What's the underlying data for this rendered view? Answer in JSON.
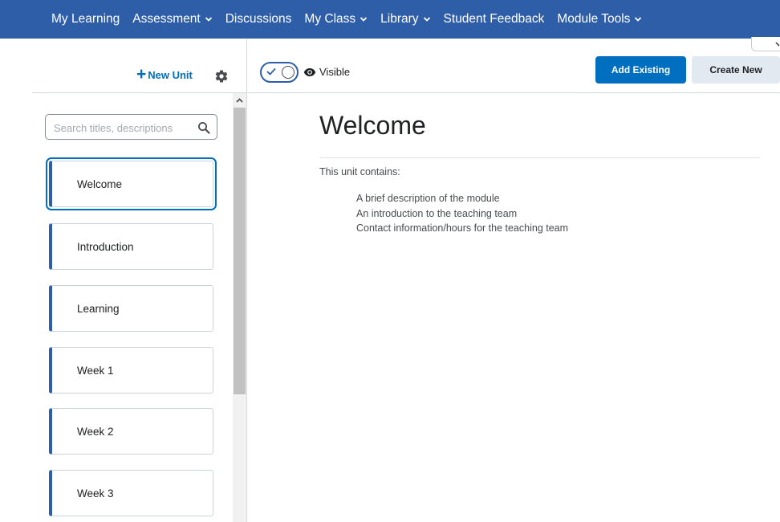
{
  "nav": {
    "items": [
      {
        "label": "My Learning",
        "dropdown": false
      },
      {
        "label": "Assessment",
        "dropdown": true
      },
      {
        "label": "Discussions",
        "dropdown": false
      },
      {
        "label": "My Class",
        "dropdown": true
      },
      {
        "label": "Library",
        "dropdown": true
      },
      {
        "label": "Student Feedback",
        "dropdown": false
      },
      {
        "label": "Module Tools",
        "dropdown": true
      }
    ]
  },
  "sidebar": {
    "new_unit_label": "New Unit",
    "search_placeholder": "Search titles, descriptions",
    "units": [
      {
        "label": "Welcome",
        "selected": true
      },
      {
        "label": "Introduction",
        "selected": false
      },
      {
        "label": "Learning",
        "selected": false
      },
      {
        "label": "Week 1",
        "selected": false
      },
      {
        "label": "Week 2",
        "selected": false
      },
      {
        "label": "Week 3",
        "selected": false
      }
    ]
  },
  "main": {
    "visibility_label": "Visible",
    "visibility_on": true,
    "add_existing_label": "Add Existing",
    "create_new_label": "Create New",
    "title": "Welcome",
    "intro": "This unit contains:",
    "contents": [
      "A brief description of the module",
      "An introduction to the teaching team",
      "Contact information/hours for the teaching team"
    ]
  },
  "colors": {
    "nav_background": "#2f5ea8",
    "primary": "#006fbf",
    "unit_accent": "#2f5ea8"
  }
}
